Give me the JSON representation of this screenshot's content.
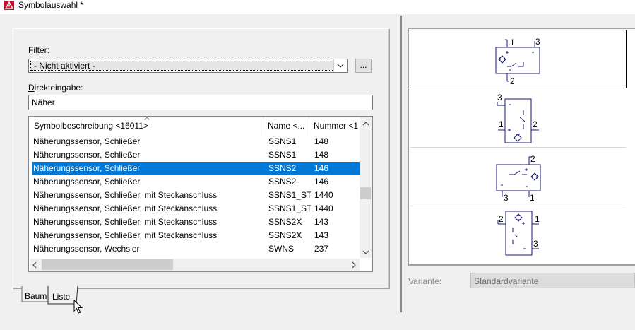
{
  "window": {
    "title": "Symbolauswahl *"
  },
  "filter": {
    "label_underlined": "F",
    "label_rest": "ilter:",
    "value": "- Nicht aktiviert -",
    "more_button": "..."
  },
  "direct_input": {
    "label_underlined": "D",
    "label_rest": "irekteingabe:",
    "value": "Näher"
  },
  "list": {
    "columns": [
      "Symbolbeschreibung <16011>",
      "Name <...",
      "Nummer <1"
    ],
    "rows": [
      {
        "desc": "Näherungssensor, Schließer",
        "name": "SSNS1",
        "number": "148"
      },
      {
        "desc": "Näherungssensor, Schließer",
        "name": "SSNS1",
        "number": "148"
      },
      {
        "desc": "Näherungssensor, Schließer",
        "name": "SSNS2",
        "number": "146",
        "selected": true
      },
      {
        "desc": "Näherungssensor, Schließer",
        "name": "SSNS2",
        "number": "146"
      },
      {
        "desc": "Näherungssensor, Schließer, mit Steckanschluss",
        "name": "SSNS1_ST",
        "number": "1440"
      },
      {
        "desc": "Näherungssensor, Schließer, mit Steckanschluss",
        "name": "SSNS1_ST",
        "number": "1440"
      },
      {
        "desc": "Näherungssensor, Schließer, mit Steckanschluss",
        "name": "SSNS2X",
        "number": "143"
      },
      {
        "desc": "Näherungssensor, Schließer, mit Steckanschluss",
        "name": "SSNS2X",
        "number": "143"
      },
      {
        "desc": "Näherungssensor, Wechsler",
        "name": "SWNS",
        "number": "237"
      }
    ]
  },
  "tabs": [
    {
      "label": "Baum"
    },
    {
      "label": "Liste",
      "active": true
    }
  ],
  "symbols": [
    {
      "pins": [
        "1",
        "3",
        "2"
      ],
      "selected": true
    },
    {
      "pins": [
        "3",
        "1",
        "2"
      ]
    },
    {
      "pins": [
        "2",
        "3",
        "1"
      ]
    },
    {
      "pins": [
        "2",
        "1",
        "3"
      ]
    }
  ],
  "variant": {
    "label_underlined": "V",
    "label_rest": "ariante:",
    "value": "Standardvariante"
  },
  "colors": {
    "accent": "#0078d7",
    "symbol_stroke": "#1a1a7a"
  }
}
